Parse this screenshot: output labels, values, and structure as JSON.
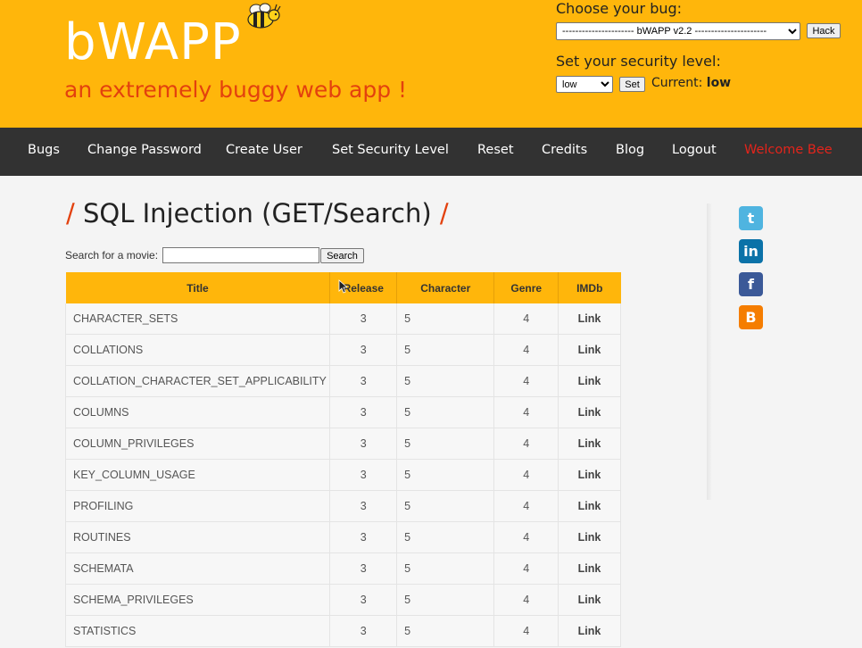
{
  "header": {
    "logo": "bWAPP",
    "tagline": "an extremely buggy web app !",
    "choose_bug_label": "Choose your bug:",
    "bug_select_value": "---------------------- bWAPP v2.2 ----------------------",
    "hack_label": "Hack",
    "security_label": "Set your security level:",
    "security_value": "low",
    "set_label": "Set",
    "current_label": "Current:",
    "current_value": "low"
  },
  "menu": [
    "Bugs",
    "Change Password",
    "Create User",
    "Set Security Level",
    "Reset",
    "Credits",
    "Blog",
    "Logout",
    "Welcome Bee"
  ],
  "page": {
    "title": "SQL Injection (GET/Search)",
    "search_label": "Search for a movie:",
    "search_value": "",
    "search_button": "Search"
  },
  "table": {
    "headers": [
      "Title",
      "Release",
      "Character",
      "Genre",
      "IMDb"
    ],
    "rows": [
      [
        "CHARACTER_SETS",
        "3",
        "5",
        "4",
        "Link"
      ],
      [
        "COLLATIONS",
        "3",
        "5",
        "4",
        "Link"
      ],
      [
        "COLLATION_CHARACTER_SET_APPLICABILITY",
        "3",
        "5",
        "4",
        "Link"
      ],
      [
        "COLUMNS",
        "3",
        "5",
        "4",
        "Link"
      ],
      [
        "COLUMN_PRIVILEGES",
        "3",
        "5",
        "4",
        "Link"
      ],
      [
        "KEY_COLUMN_USAGE",
        "3",
        "5",
        "4",
        "Link"
      ],
      [
        "PROFILING",
        "3",
        "5",
        "4",
        "Link"
      ],
      [
        "ROUTINES",
        "3",
        "5",
        "4",
        "Link"
      ],
      [
        "SCHEMATA",
        "3",
        "5",
        "4",
        "Link"
      ],
      [
        "SCHEMA_PRIVILEGES",
        "3",
        "5",
        "4",
        "Link"
      ],
      [
        "STATISTICS",
        "3",
        "5",
        "4",
        "Link"
      ]
    ]
  },
  "social": [
    {
      "icon": "twitter-icon",
      "color": "#4fb4e0"
    },
    {
      "icon": "linkedin-icon",
      "color": "#0b72a8"
    },
    {
      "icon": "facebook-icon",
      "color": "#3b5998"
    },
    {
      "icon": "blogger-icon",
      "color": "#f57d00"
    }
  ],
  "colors": {
    "header_bg": "#ffb60b",
    "menu_bg": "#323232",
    "accent_red": "#e3410e",
    "welcome_red": "#e3241b"
  }
}
